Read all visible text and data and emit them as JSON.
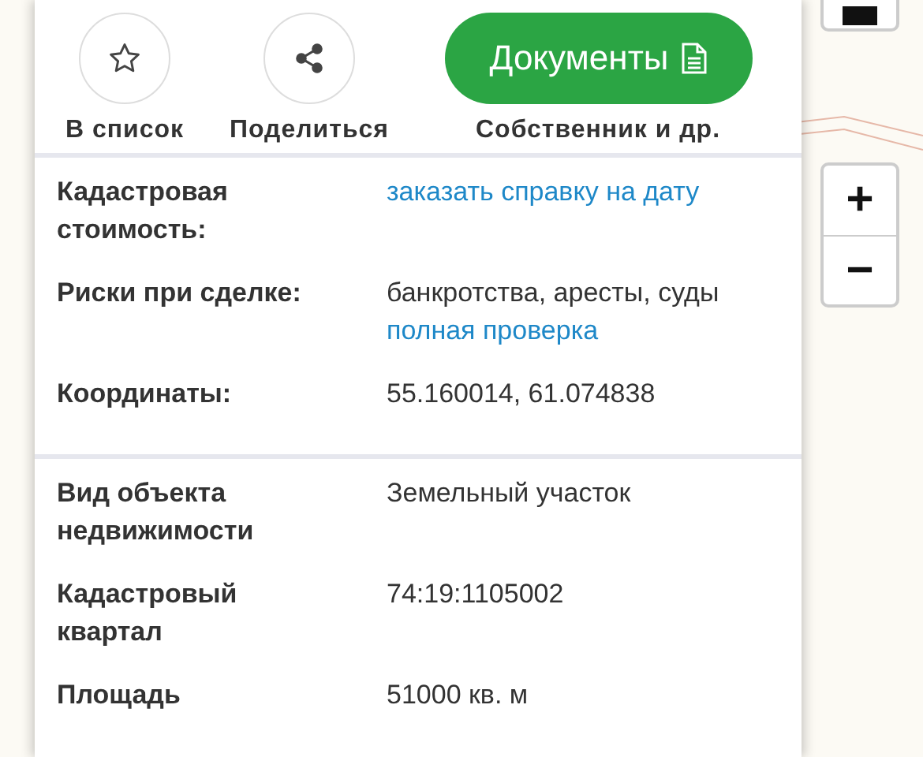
{
  "actions": [
    {
      "kind": "favorite",
      "label": "В список"
    },
    {
      "kind": "share",
      "label": "Поделиться"
    },
    {
      "kind": "primary",
      "button": "Документы",
      "label": "Собственник и др."
    }
  ],
  "sections": [
    {
      "rows": [
        {
          "label": "Кадастровая стоимость:",
          "values": [
            {
              "kind": "link",
              "text": "заказать справку на дату"
            }
          ]
        },
        {
          "label": "Риски при сделке:",
          "values": [
            {
              "kind": "text",
              "text": "банкротства, аресты, суды"
            },
            {
              "kind": "link",
              "text": "полная проверка"
            }
          ]
        },
        {
          "label": "Координаты:",
          "values": [
            {
              "kind": "text",
              "text": "55.160014, 61.074838"
            }
          ]
        }
      ]
    },
    {
      "rows": [
        {
          "label": "Вид объекта недвижимости",
          "values": [
            {
              "kind": "text",
              "text": "Земельный участок"
            }
          ]
        },
        {
          "label": "Кадастровый квартал",
          "values": [
            {
              "kind": "text",
              "text": "74:19:1105002"
            }
          ]
        },
        {
          "label": "Площадь",
          "values": [
            {
              "kind": "text",
              "text": "51000 кв. м"
            }
          ]
        }
      ]
    }
  ],
  "map_controls": {
    "zoom_in": "+",
    "zoom_out": "−"
  }
}
